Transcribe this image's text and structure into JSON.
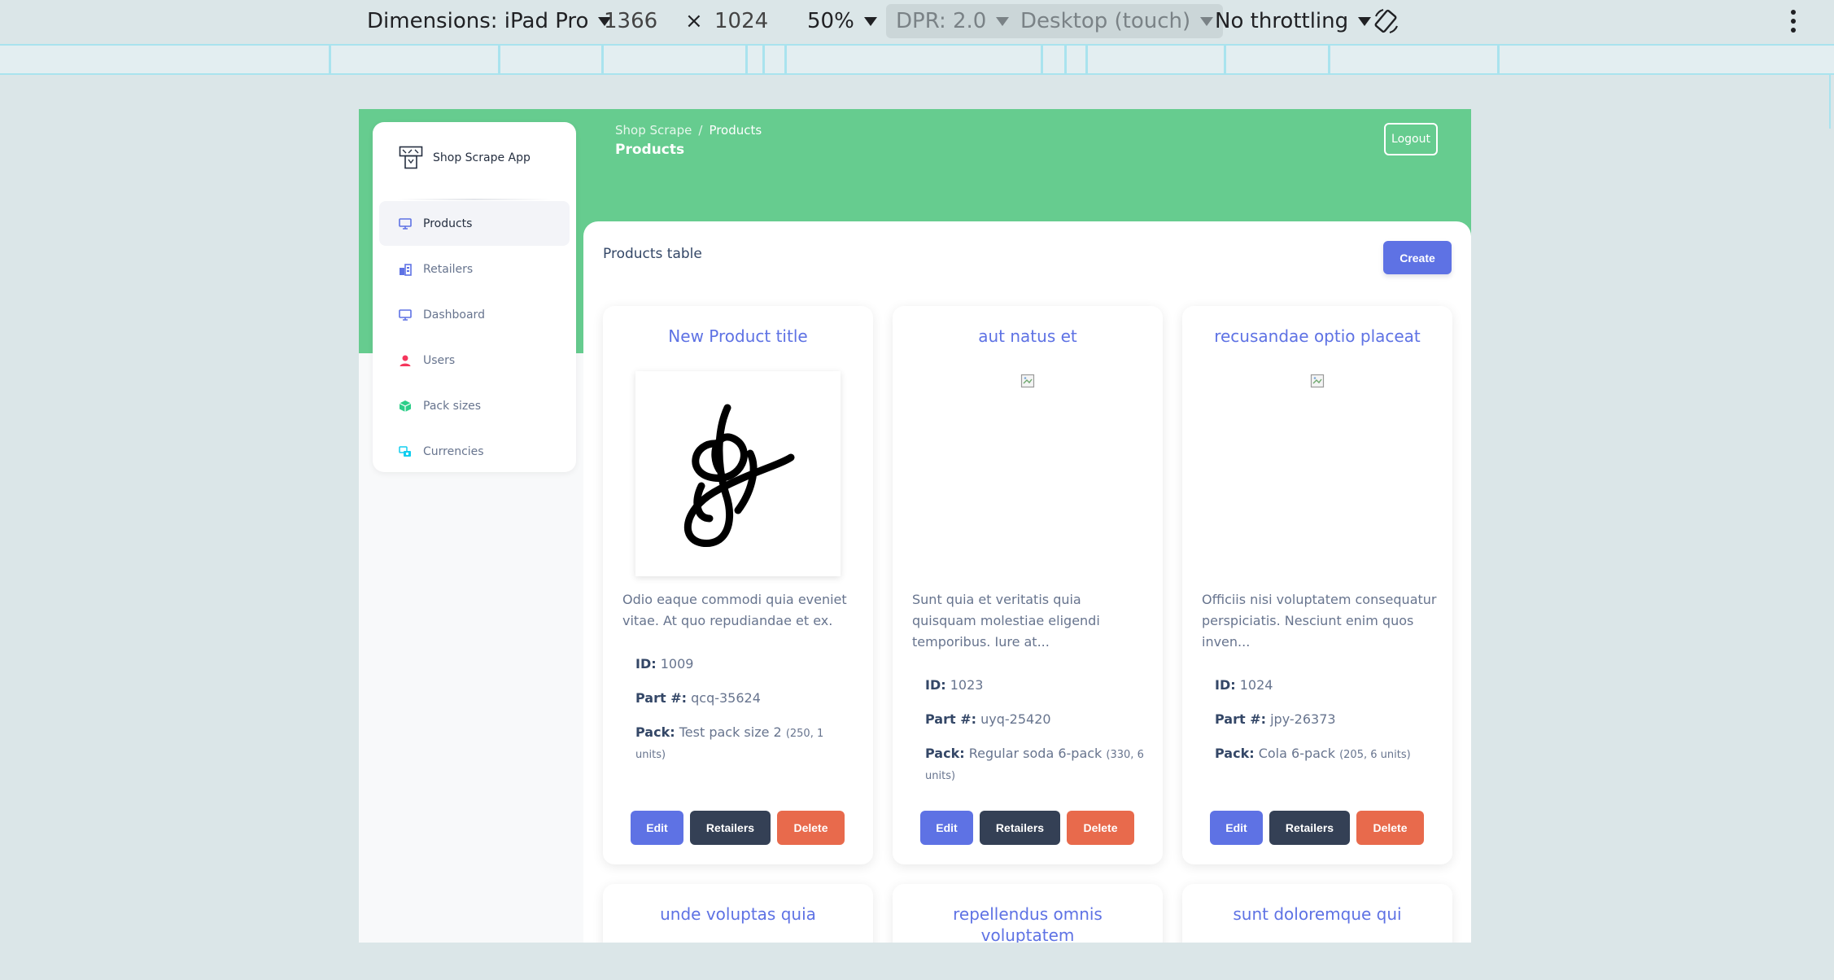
{
  "devtools": {
    "dimensions_label": "Dimensions: iPad Pro",
    "width": "1366",
    "times": "×",
    "height": "1024",
    "zoom": "50%",
    "dpr": "DPR: 2.0",
    "mode": "Desktop (touch)",
    "throttling": "No throttling"
  },
  "app": {
    "brand": "Shop Scrape App",
    "breadcrumb": {
      "root": "Shop Scrape",
      "separator": "/",
      "current": "Products"
    },
    "page_title": "Products",
    "logout_label": "Logout"
  },
  "sidebar": {
    "items": [
      {
        "label": "Products",
        "icon": "monitor-icon",
        "active": true
      },
      {
        "label": "Retailers",
        "icon": "building-icon"
      },
      {
        "label": "Dashboard",
        "icon": "monitor-icon"
      },
      {
        "label": "Users",
        "icon": "user-icon"
      },
      {
        "label": "Pack sizes",
        "icon": "box-icon"
      },
      {
        "label": "Currencies",
        "icon": "currency-icon"
      }
    ]
  },
  "main": {
    "table_title": "Products table",
    "create_label": "Create",
    "labels": {
      "id": "ID:",
      "part": "Part #:",
      "pack": "Pack:"
    },
    "buttons": {
      "edit": "Edit",
      "retailers": "Retailers",
      "delete": "Delete"
    },
    "products": [
      {
        "title": "New Product title",
        "description": "Odio eaque commodi quia eveniet vitae. At quo repudiandae et ex.",
        "id": "1009",
        "part": "qcq-35624",
        "pack": "Test pack size 2",
        "pack_detail": "(250, 1 units)"
      },
      {
        "title": "aut natus et",
        "description": "Sunt quia et veritatis quia quisquam molestiae eligendi temporibus. Iure at...",
        "id": "1023",
        "part": "uyq-25420",
        "pack": "Regular soda 6-pack",
        "pack_detail": "(330, 6 units)"
      },
      {
        "title": "recusandae optio placeat",
        "description": "Officiis nisi voluptatem consequatur perspiciatis. Nesciunt enim quos inven...",
        "id": "1024",
        "part": "jpy-26373",
        "pack": "Cola 6-pack",
        "pack_detail": "(205, 6 units)"
      },
      {
        "title": "unde voluptas quia"
      },
      {
        "title": "repellendus omnis voluptatem"
      },
      {
        "title": "sunt doloremque qui"
      }
    ]
  },
  "colors": {
    "header_green": "#66cc8f",
    "primary": "#5e72e4",
    "dark": "#344055",
    "danger": "#e86a4c"
  }
}
